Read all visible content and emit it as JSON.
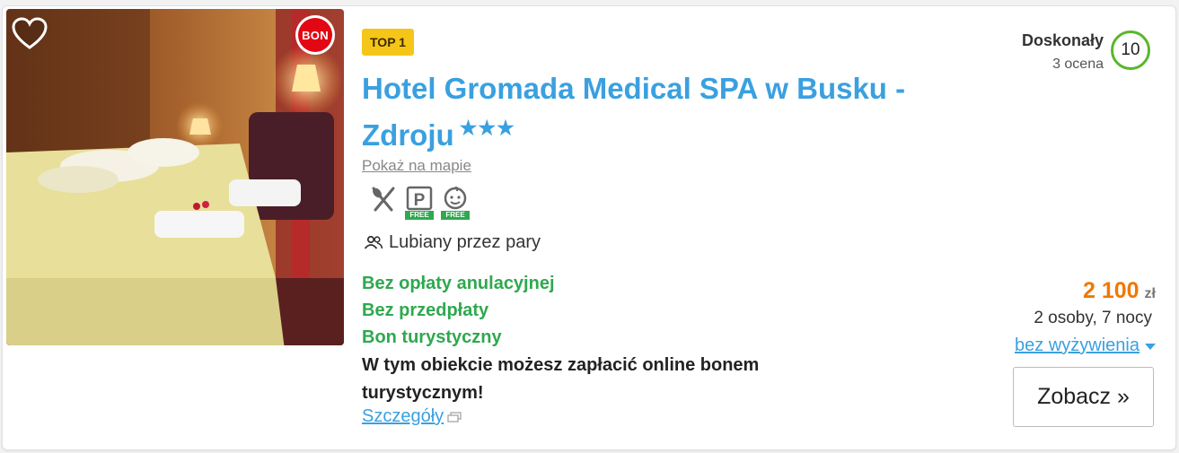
{
  "badges": {
    "top": "TOP 1",
    "bon": "BON"
  },
  "hotel": {
    "name": "Hotel Gromada Medical SPA w Busku - Zdroju",
    "stars": "★★★",
    "map_link": "Pokaż na mapie"
  },
  "amenities": [
    {
      "icon": "restaurant-icon",
      "free_label": ""
    },
    {
      "icon": "parking-icon",
      "free_label": "FREE"
    },
    {
      "icon": "kids-icon",
      "free_label": "FREE"
    }
  ],
  "popular_with": "Lubiany przez pary",
  "perks": {
    "cancellation": "Bez opłaty anulacyjnej",
    "prepayment": "Bez przedpłaty",
    "voucher": "Bon turystyczny"
  },
  "voucher_info": "W tym obiekcie możesz zapłacić online bonem turystycznym!",
  "details_link": "Szczegóły",
  "rating": {
    "label": "Doskonały",
    "count": "3 ocena",
    "score": "10"
  },
  "price": {
    "amount": "2 100",
    "currency": "zł",
    "persons": "2 osoby, 7 nocy",
    "board": "bez wyżywienia"
  },
  "cta": "Zobacz »",
  "colors": {
    "link": "#3aa0e0",
    "green": "#2fa84f",
    "price": "#f07800",
    "badge": "#f5c518",
    "bon": "#e30613"
  }
}
